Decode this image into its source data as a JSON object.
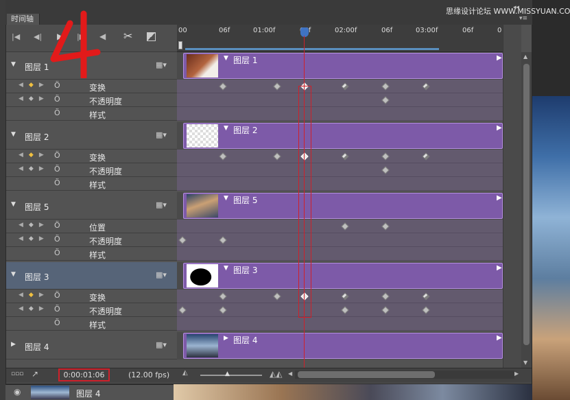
{
  "header": {
    "panel_tab": "时间轴",
    "watermark": "思缘设计论坛 WWW.MISSYUAN.COM"
  },
  "ruler": {
    "labels": [
      "00",
      "06f",
      "01:00f",
      "06f",
      "02:00f",
      "06f",
      "03:00f",
      "06f",
      "0"
    ]
  },
  "layers": [
    {
      "name": "图层 1",
      "clip_label": "图层 1",
      "expanded": true,
      "thumb": "hand",
      "props": [
        {
          "label": "变换",
          "nav_active": true,
          "keyframes": [
            325,
            404,
            444,
            503,
            562,
            621
          ]
        },
        {
          "label": "不透明度",
          "nav_active": false,
          "keyframes": [
            562
          ]
        },
        {
          "label": "样式",
          "nav_active": false,
          "keyframes": []
        }
      ]
    },
    {
      "name": "图层 2",
      "clip_label": "图层 2",
      "expanded": true,
      "thumb": "transparent",
      "props": [
        {
          "label": "变换",
          "nav_active": true,
          "keyframes": [
            325,
            404,
            444,
            503,
            562,
            621
          ]
        },
        {
          "label": "不透明度",
          "nav_active": false,
          "keyframes": [
            562
          ]
        },
        {
          "label": "样式",
          "nav_active": false,
          "keyframes": []
        }
      ]
    },
    {
      "name": "图层 5",
      "clip_label": "图层 5",
      "expanded": true,
      "thumb": "city",
      "props": [
        {
          "label": "位置",
          "nav_active": false,
          "keyframes": [
            503,
            562
          ]
        },
        {
          "label": "不透明度",
          "nav_active": false,
          "keyframes": [
            266,
            325
          ]
        },
        {
          "label": "样式",
          "nav_active": false,
          "keyframes": []
        }
      ]
    },
    {
      "name": "图层 3",
      "clip_label": "图层 3",
      "expanded": true,
      "selected": true,
      "thumb": "blob",
      "props": [
        {
          "label": "变换",
          "nav_active": true,
          "keyframes": [
            325,
            404,
            444,
            503,
            562,
            621
          ]
        },
        {
          "label": "不透明度",
          "nav_active": false,
          "keyframes": [
            266,
            325,
            503,
            562,
            621
          ]
        },
        {
          "label": "样式",
          "nav_active": false,
          "keyframes": []
        }
      ]
    },
    {
      "name": "图层 4",
      "clip_label": "图层 4",
      "expanded": false,
      "thumb": "sky",
      "props": []
    }
  ],
  "footer": {
    "timecode": "0:00:01:06",
    "fps": "(12.00 fps)"
  },
  "layers_panel_row": {
    "label": "图层 4"
  },
  "annotation": {
    "number": "4"
  },
  "colors": {
    "clip": "#7d5aa8",
    "clip_border": "#b58fe0",
    "playhead": "#d0202a",
    "highlight_box": "#d0202a",
    "selected_row": "#566478"
  }
}
